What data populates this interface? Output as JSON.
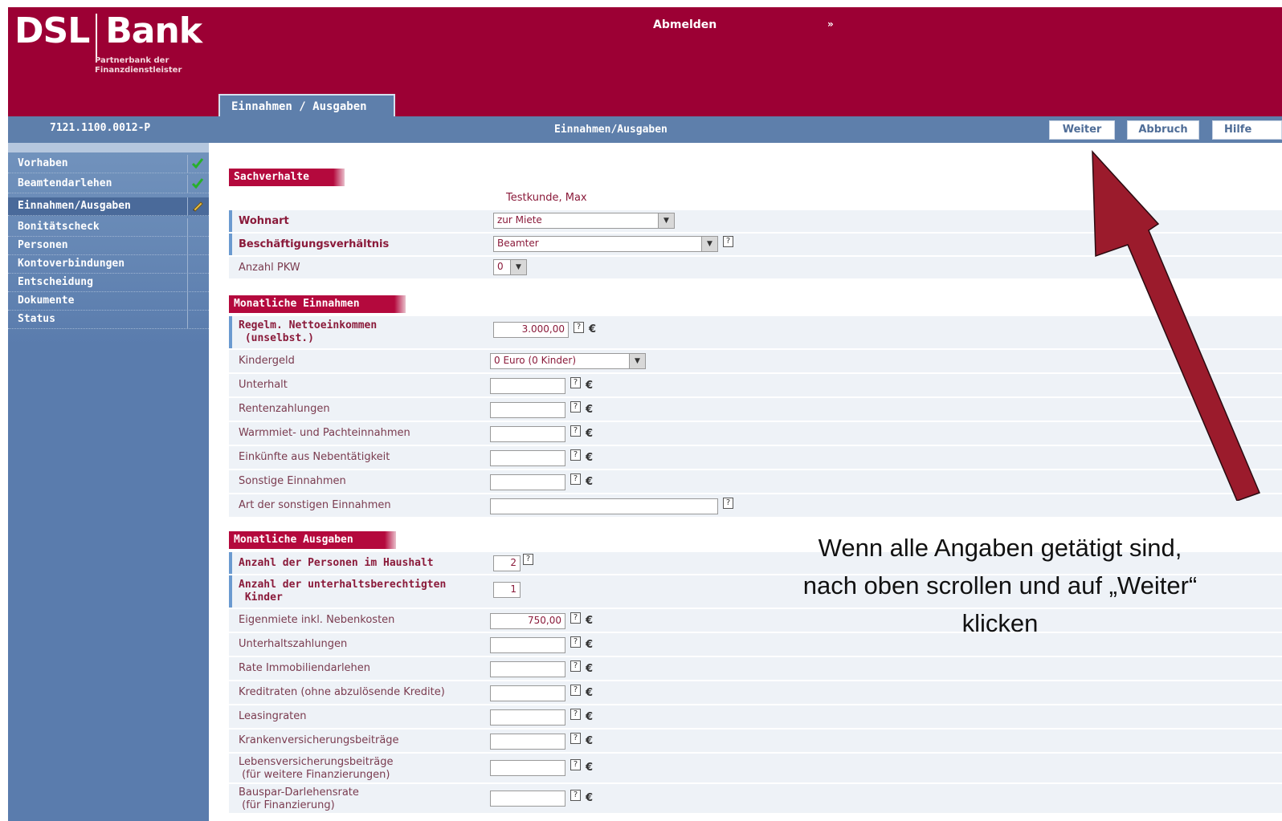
{
  "header": {
    "brand_left": "DSL",
    "brand_right": "Bank",
    "brand_sub_1": "Partnerbank der",
    "brand_sub_2": "Finanzdienstleister",
    "logout": "Abmelden",
    "logout_icon": "»",
    "tab": "Einnahmen / Ausgaben"
  },
  "bar": {
    "case_id": "7121.1100.0012-P",
    "title": "Einnahmen/Ausgaben",
    "buttons": {
      "next": "Weiter",
      "cancel": "Abbruch",
      "help": "Hilfe"
    }
  },
  "sidebar": {
    "items": [
      {
        "label": "Vorhaben",
        "status": "check-icon"
      },
      {
        "label": "Beamtendarlehen",
        "status": "check-icon"
      },
      {
        "label": "Einnahmen/Ausgaben",
        "status": "pencil-icon"
      },
      {
        "label": "Bonitätscheck"
      },
      {
        "label": "Personen"
      },
      {
        "label": "Kontoverbindungen"
      },
      {
        "label": "Entscheidung"
      },
      {
        "label": "Dokumente"
      },
      {
        "label": "Status"
      }
    ]
  },
  "form": {
    "sect1": {
      "title": "Sachverhalte",
      "customer": "Testkunde, Max",
      "wohnart_label": "Wohnart",
      "wohnart_value": "zur Miete",
      "beschaeftigung_label": "Beschäftigungsverhältnis",
      "beschaeftigung_value": "Beamter",
      "pkw_label": "Anzahl PKW",
      "pkw_value": "0"
    },
    "sect2": {
      "title": "Monatliche Einnahmen",
      "netto_label_1": "Regelm. Nettoeinkommen",
      "netto_label_2": "(unselbst.)",
      "netto_value": "3.000,00",
      "kindergeld_label": "Kindergeld",
      "kindergeld_value": "0 Euro (0 Kinder)",
      "unterhalt_label": "Unterhalt",
      "renten_label": "Rentenzahlungen",
      "warmmiet_label": "Warmmiet- und Pachteinnahmen",
      "neben_label": "Einkünfte aus Nebentätigkeit",
      "sonstige_label": "Sonstige Einnahmen",
      "art_label": "Art der sonstigen Einnahmen"
    },
    "sect3": {
      "title": "Monatliche Ausgaben",
      "personen_label": "Anzahl der Personen im Haushalt",
      "personen_value": "2",
      "kinder_label_1": "Anzahl der unterhaltsberechtigten",
      "kinder_label_2": "Kinder",
      "kinder_value": "1",
      "eigenmiete_label": "Eigenmiete inkl. Nebenkosten",
      "eigenmiete_value": "750,00",
      "unterhaltszahlungen_label": "Unterhaltszahlungen",
      "rate_label": "Rate Immobiliendarlehen",
      "kredit_label": "Kreditraten (ohne abzulösende Kredite)",
      "leasing_label": "Leasingraten",
      "kranken_label": "Krankenversicherungsbeiträge",
      "leben_label_1": "Lebensversicherungsbeiträge",
      "leben_label_2": "(für weitere Finanzierungen)",
      "bauspar_label_1": "Bauspar-Darlehensrate",
      "bauspar_label_2": "(für Finanzierung)"
    },
    "euro": "€",
    "help": "?"
  },
  "annotation": {
    "line1": "Wenn alle Angaben getätigt sind,",
    "line2": "nach oben scrollen und auf „Weiter“",
    "line3": "klicken"
  },
  "colors": {
    "brand": "#9c0034",
    "bar": "#5e7fab",
    "section": "#b4093d",
    "arrow": "#9b1b2c"
  }
}
